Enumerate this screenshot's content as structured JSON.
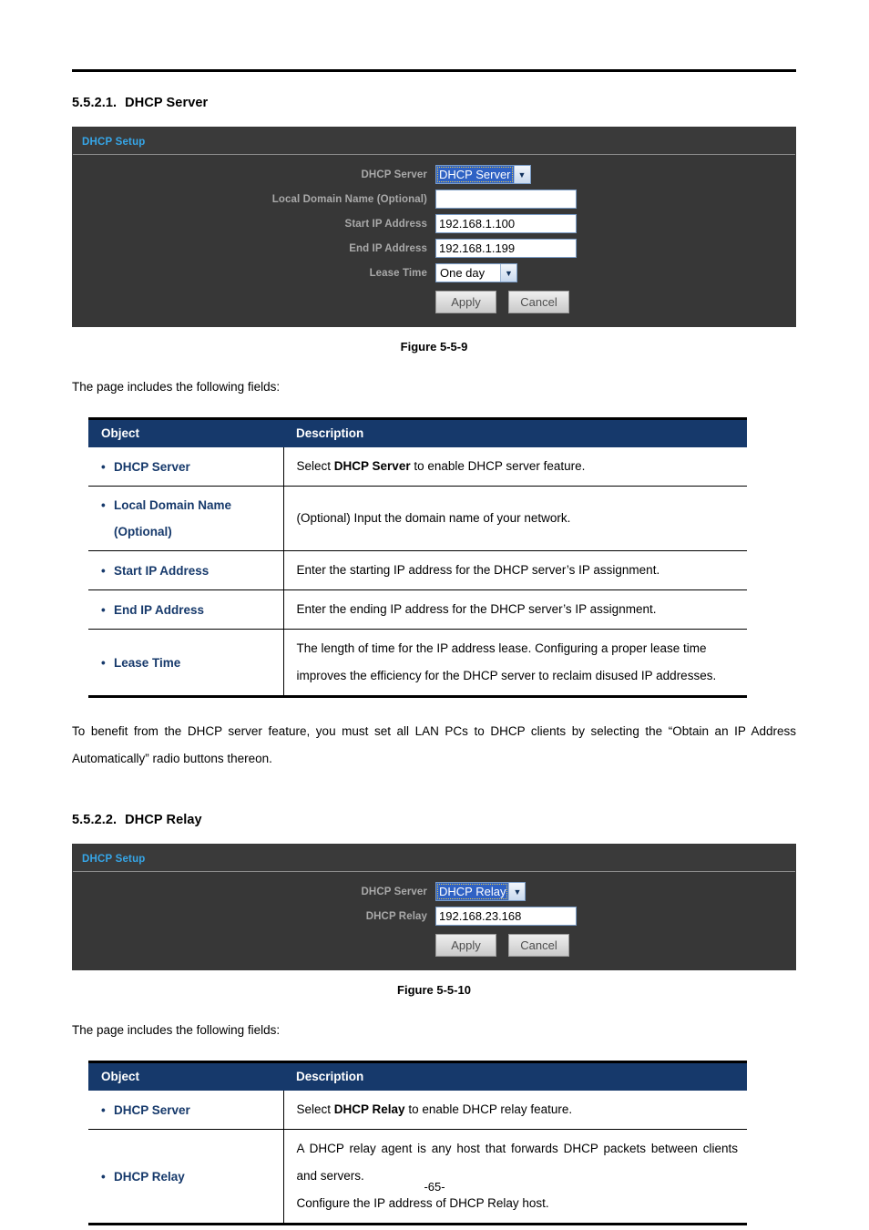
{
  "document": {
    "page_number": "-65-"
  },
  "sections": [
    {
      "number": "5.5.2.1.",
      "title": "DHCP Server",
      "panel": {
        "title": "DHCP Setup",
        "rows": [
          {
            "label": "DHCP Server",
            "type": "select-focus",
            "value": "DHCP Server"
          },
          {
            "label": "Local Domain Name (Optional)",
            "type": "text",
            "value": ""
          },
          {
            "label": "Start IP Address",
            "type": "text",
            "value": "192.168.1.100"
          },
          {
            "label": "End IP Address",
            "type": "text",
            "value": "192.168.1.199"
          },
          {
            "label": "Lease Time",
            "type": "select",
            "value": "One day"
          }
        ],
        "apply_label": "Apply",
        "cancel_label": "Cancel"
      },
      "figure_caption": "Figure 5-5-9",
      "intro": "The page includes the following fields:",
      "table": {
        "headers": {
          "object": "Object",
          "description": "Description"
        },
        "rows": [
          {
            "object": "DHCP Server",
            "object_line2": "",
            "desc_pre": "Select ",
            "desc_bold": "DHCP Server",
            "desc_post": " to enable DHCP server feature.",
            "desc_extra": []
          },
          {
            "object": "Local Domain Name",
            "object_line2": "(Optional)",
            "desc_pre": "(Optional) Input the domain name of your network.",
            "desc_bold": "",
            "desc_post": "",
            "desc_extra": []
          },
          {
            "object": "Start IP Address",
            "object_line2": "",
            "desc_pre": "Enter the starting IP address for the DHCP server’s IP assignment.",
            "desc_bold": "",
            "desc_post": "",
            "desc_extra": []
          },
          {
            "object": "End IP Address",
            "object_line2": "",
            "desc_pre": "Enter the ending IP address for the DHCP server’s IP assignment.",
            "desc_bold": "",
            "desc_post": "",
            "desc_extra": []
          },
          {
            "object": "Lease Time",
            "object_line2": "",
            "desc_pre": "The length of time for the IP address lease. Configuring a proper lease time improves the efficiency for the DHCP server to reclaim disused IP addresses.",
            "desc_bold": "",
            "desc_post": "",
            "desc_extra": []
          }
        ]
      },
      "note": "To benefit from the DHCP server feature, you must set all LAN PCs to DHCP clients by selecting the “Obtain an IP Address Automatically” radio buttons thereon."
    },
    {
      "number": "5.5.2.2.",
      "title": "DHCP Relay",
      "panel": {
        "title": "DHCP Setup",
        "rows": [
          {
            "label": "DHCP Server",
            "type": "select-focus",
            "value": "DHCP Relay"
          },
          {
            "label": "DHCP Relay",
            "type": "text",
            "value": "192.168.23.168"
          }
        ],
        "apply_label": "Apply",
        "cancel_label": "Cancel"
      },
      "figure_caption": "Figure 5-5-10",
      "intro": "The page includes the following fields:",
      "table": {
        "headers": {
          "object": "Object",
          "description": "Description"
        },
        "rows": [
          {
            "object": "DHCP Server",
            "object_line2": "",
            "desc_pre": "Select ",
            "desc_bold": "DHCP Relay",
            "desc_post": " to enable DHCP relay feature.",
            "desc_extra": []
          },
          {
            "object": "DHCP Relay",
            "object_line2": "",
            "desc_pre": "A DHCP relay agent is any host that forwards DHCP packets between clients and servers.",
            "desc_bold": "",
            "desc_post": "",
            "desc_extra": [
              "Configure the IP address of DHCP Relay host."
            ]
          }
        ]
      },
      "note": ""
    }
  ]
}
